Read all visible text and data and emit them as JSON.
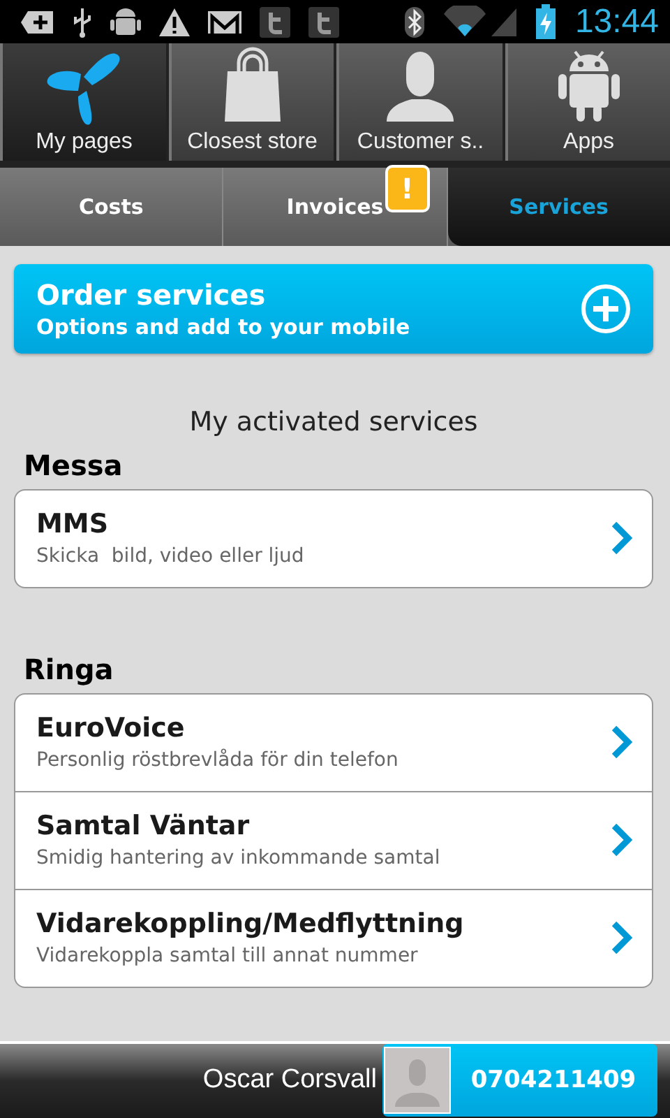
{
  "status_bar": {
    "time": "13:44"
  },
  "shortcuts": [
    {
      "label": "My pages",
      "kind": "logo",
      "selected": true
    },
    {
      "label": "Closest store",
      "kind": "bag",
      "selected": false
    },
    {
      "label": "Customer s..",
      "kind": "person",
      "selected": false
    },
    {
      "label": "Apps",
      "kind": "android",
      "selected": false
    }
  ],
  "tabs": [
    {
      "label": "Costs",
      "selected": false
    },
    {
      "label": "Invoices",
      "selected": false,
      "badge": "!"
    },
    {
      "label": "Services",
      "selected": true
    }
  ],
  "order_banner": {
    "title": "Order services",
    "subtitle": "Options and add to your mobile"
  },
  "heading": "My activated services",
  "sections": [
    {
      "title": "Messa",
      "items": [
        {
          "title": "MMS",
          "subtitle": "Skicka  bild, video eller ljud"
        }
      ]
    },
    {
      "title": "Ringa",
      "items": [
        {
          "title": "EuroVoice",
          "subtitle": "Personlig röstbrevlåda för din telefon"
        },
        {
          "title": "Samtal Väntar",
          "subtitle": "Smidig hantering av inkommande samtal"
        },
        {
          "title": "Vidarekoppling/Medflyttning",
          "subtitle": "Vidarekoppla samtal till annat nummer"
        }
      ]
    }
  ],
  "footer": {
    "name": "Oscar Corsvall",
    "phone": "0704211409"
  }
}
